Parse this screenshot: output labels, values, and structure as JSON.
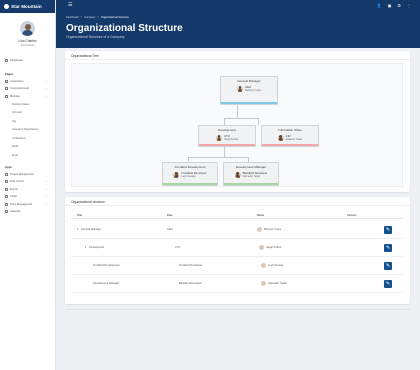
{
  "brand": {
    "name": "Star Mountain"
  },
  "profile": {
    "name": "Lion Charles",
    "role": "Administrator"
  },
  "sidebar": {
    "top_items": [
      {
        "label": "Dashboard",
        "icon": "home-icon"
      }
    ],
    "pages_label": "Pages",
    "page_items": [
      {
        "label": "Corporation",
        "icon": "building-icon"
      },
      {
        "label": "Cross-functional",
        "icon": "users-icon"
      },
      {
        "label": "Modules",
        "icon": "grid-icon"
      }
    ],
    "module_subitems": [
      "Positions Master",
      "Company",
      "Org",
      "Network & Organizations",
      "Certifications",
      "Media",
      "Email"
    ],
    "apps_label": "Apps",
    "app_items": [
      {
        "label": "Project Management",
        "icon": "folder-icon"
      },
      {
        "label": "Task Center",
        "icon": "task-icon"
      },
      {
        "label": "Events",
        "icon": "event-icon"
      },
      {
        "label": "Chats",
        "icon": "chat-icon"
      },
      {
        "label": "Team Management",
        "icon": "team-icon"
      },
      {
        "label": "Calendar",
        "icon": "calendar-icon"
      }
    ]
  },
  "topbar": {
    "menu_icon": "☰",
    "icons": [
      "👤",
      "▣",
      "⚙",
      "⋮"
    ]
  },
  "breadcrumb": {
    "items": [
      "Dashboard",
      "Company"
    ],
    "current": "Organizational Structure",
    "sep": ">"
  },
  "page": {
    "title": "Organizational Structure",
    "subtitle": "Organizational Structure of a Company"
  },
  "tree": {
    "title": "Organizational Tree",
    "nodes": {
      "root": {
        "title": "General Manager",
        "role": "CEO",
        "name": "Mehmet Yuzpe",
        "bar": "#7ec8e3"
      },
      "dev": {
        "title": "Development",
        "role": "CTO",
        "name": "Negat Korkut",
        "bar": "#f4a7a7"
      },
      "it": {
        "title": "Information Office",
        "role": "CIO",
        "name": "Alkajmer Yalpar",
        "bar": "#f4a7a7"
      },
      "front": {
        "title": "FrontEnd Development",
        "role": "FrontEnd Developer",
        "name": "Leyli Cenaiye",
        "bar": "#a7d7a0"
      },
      "back": {
        "title": "Development Manager",
        "role": "BackEnd Developer",
        "name": "Islamedin Yalpar",
        "bar": "#a7d7a0"
      }
    }
  },
  "table": {
    "title": "Organizational structure",
    "headers": {
      "unit": "Unit",
      "role": "Role",
      "name": "Name",
      "actions": "Actions"
    },
    "rows": [
      {
        "unit": "General Manager",
        "prefix": "▾",
        "role": "CEO",
        "name": "Mehmet Yuzpe",
        "indent": 0
      },
      {
        "unit": "Development",
        "prefix": "▾",
        "role": "CTO",
        "name": "Negat Korkut",
        "indent": 1
      },
      {
        "unit": "FrontEnd Development",
        "prefix": "",
        "role": "FrontEnd Developer",
        "name": "Leyli Cenaiye",
        "indent": 2
      },
      {
        "unit": "Development Manager",
        "prefix": "",
        "role": "BackEnd Developer",
        "name": "Islamedin Yalpar",
        "indent": 2
      }
    ],
    "edit_icon": "✎"
  },
  "colors": {
    "primary": "#14396b",
    "button": "#14518f",
    "background": "#eef1f4"
  }
}
